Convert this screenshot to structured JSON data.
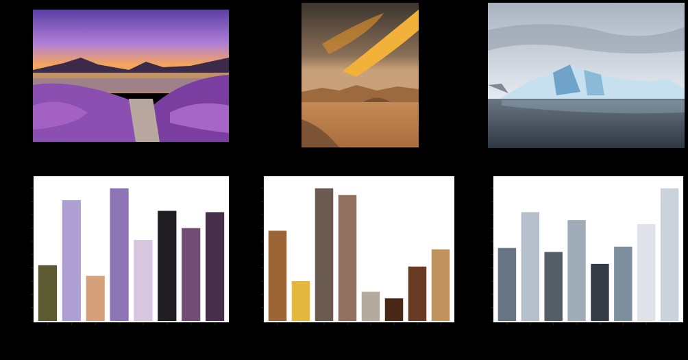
{
  "images": [
    {
      "scene": "lavender-lake-sunset",
      "colors": {
        "sky_top": "#6a4fb3",
        "sky_mid": "#b27fd9",
        "glow": "#f6a45a",
        "mountain": "#3b2a4a",
        "water": "#d9a46b",
        "flowers": "#8a4fb0",
        "foliage": "#5c6a3a"
      }
    },
    {
      "scene": "desert-dusk",
      "colors": {
        "sky_top": "#3e3a34",
        "cloud": "#f2b23a",
        "horizon": "#c8a07a",
        "sand": "#c48a55",
        "dune": "#9c6a3e"
      }
    },
    {
      "scene": "iceberg-sea",
      "colors": {
        "sky_top": "#a9b3c0",
        "sky_bottom": "#dfe4ea",
        "ice": "#bfd9ea",
        "ice_shadow": "#6fa3c9",
        "water_top": "#6b7684",
        "water_bottom": "#2e3842"
      }
    }
  ],
  "chart_data": [
    {
      "type": "bar",
      "values": [
        4.2,
        9.1,
        3.4,
        10.0,
        6.1,
        8.3,
        7.0,
        8.2
      ],
      "colors": [
        "#5c5a30",
        "#ae9fd2",
        "#d6a07a",
        "#8d74b5",
        "#d8c5e0",
        "#1f1c22",
        "#734c74",
        "#472e4a"
      ],
      "ylim": [
        0,
        10.5
      ]
    },
    {
      "type": "bar",
      "values": [
        6.8,
        3.0,
        10.0,
        9.5,
        2.2,
        1.7,
        4.1,
        5.4
      ],
      "colors": [
        "#9c6535",
        "#e3b83c",
        "#6a5a50",
        "#927060",
        "#b4aa9e",
        "#4a2818",
        "#6b3a22",
        "#c0935e"
      ],
      "ylim": [
        0,
        10.5
      ]
    },
    {
      "type": "bar",
      "values": [
        5.5,
        8.2,
        5.2,
        7.6,
        4.3,
        5.6,
        7.3,
        10.0
      ],
      "colors": [
        "#677582",
        "#b5c0cc",
        "#545e66",
        "#a0acb8",
        "#363c46",
        "#7d8e9c",
        "#dfe2e8",
        "#cad2dc"
      ],
      "ylim": [
        0,
        10.5
      ]
    }
  ]
}
